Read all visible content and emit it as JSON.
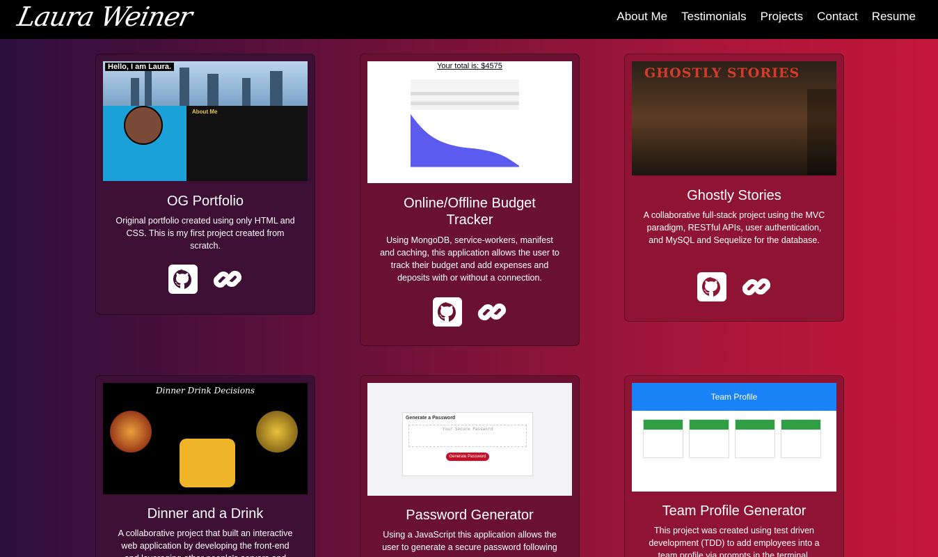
{
  "brand": "Laura Weiner",
  "nav": [
    "About Me",
    "Testimonials",
    "Projects",
    "Contact",
    "Resume"
  ],
  "projects": [
    {
      "title": "OG Portfolio",
      "desc": "Original portfolio created using only HTML and CSS. This is my first project created from scratch.",
      "thumb_text": "Hello, I am Laura.",
      "thumb_sub": "About Me"
    },
    {
      "title": "Online/Offline Budget Tracker",
      "desc": "Using MongoDB, service-workers, manifest and caching, this application allows the user to track their budget and add expenses and deposits with or without a connection.",
      "thumb_text": "Your total is: $4575"
    },
    {
      "title": "Ghostly Stories",
      "desc": "A collaborative full-stack project using the MVC paradigm, RESTful APIs, user authentication, and MySQL and Sequelize for the database.",
      "thumb_text": "GHOSTLY STORIES"
    },
    {
      "title": "Dinner and a Drink",
      "desc": "A collaborative project that built an interactive web application by developing the front-end and leveraging other people's servers and",
      "thumb_text": "Dinner Drink Decisions"
    },
    {
      "title": "Password Generator",
      "desc": "Using a JavaScript this application allows the user to generate a secure password following",
      "thumb_text": "Generate a Password",
      "thumb_btn": "Generate Password",
      "thumb_placeholder": "Your Secure Password"
    },
    {
      "title": "Team Profile Generator",
      "desc": "This project was created using test driven development (TDD) to add employees into a team profile via prompts in the terminal.",
      "thumb_text": "Team Profile"
    }
  ],
  "icons": [
    "github-icon",
    "link-icon"
  ],
  "colors": {
    "navbar": "#000000",
    "card_left": "#3e0f35",
    "card_mid": "#6a1132",
    "card_right": "#8f1433"
  }
}
